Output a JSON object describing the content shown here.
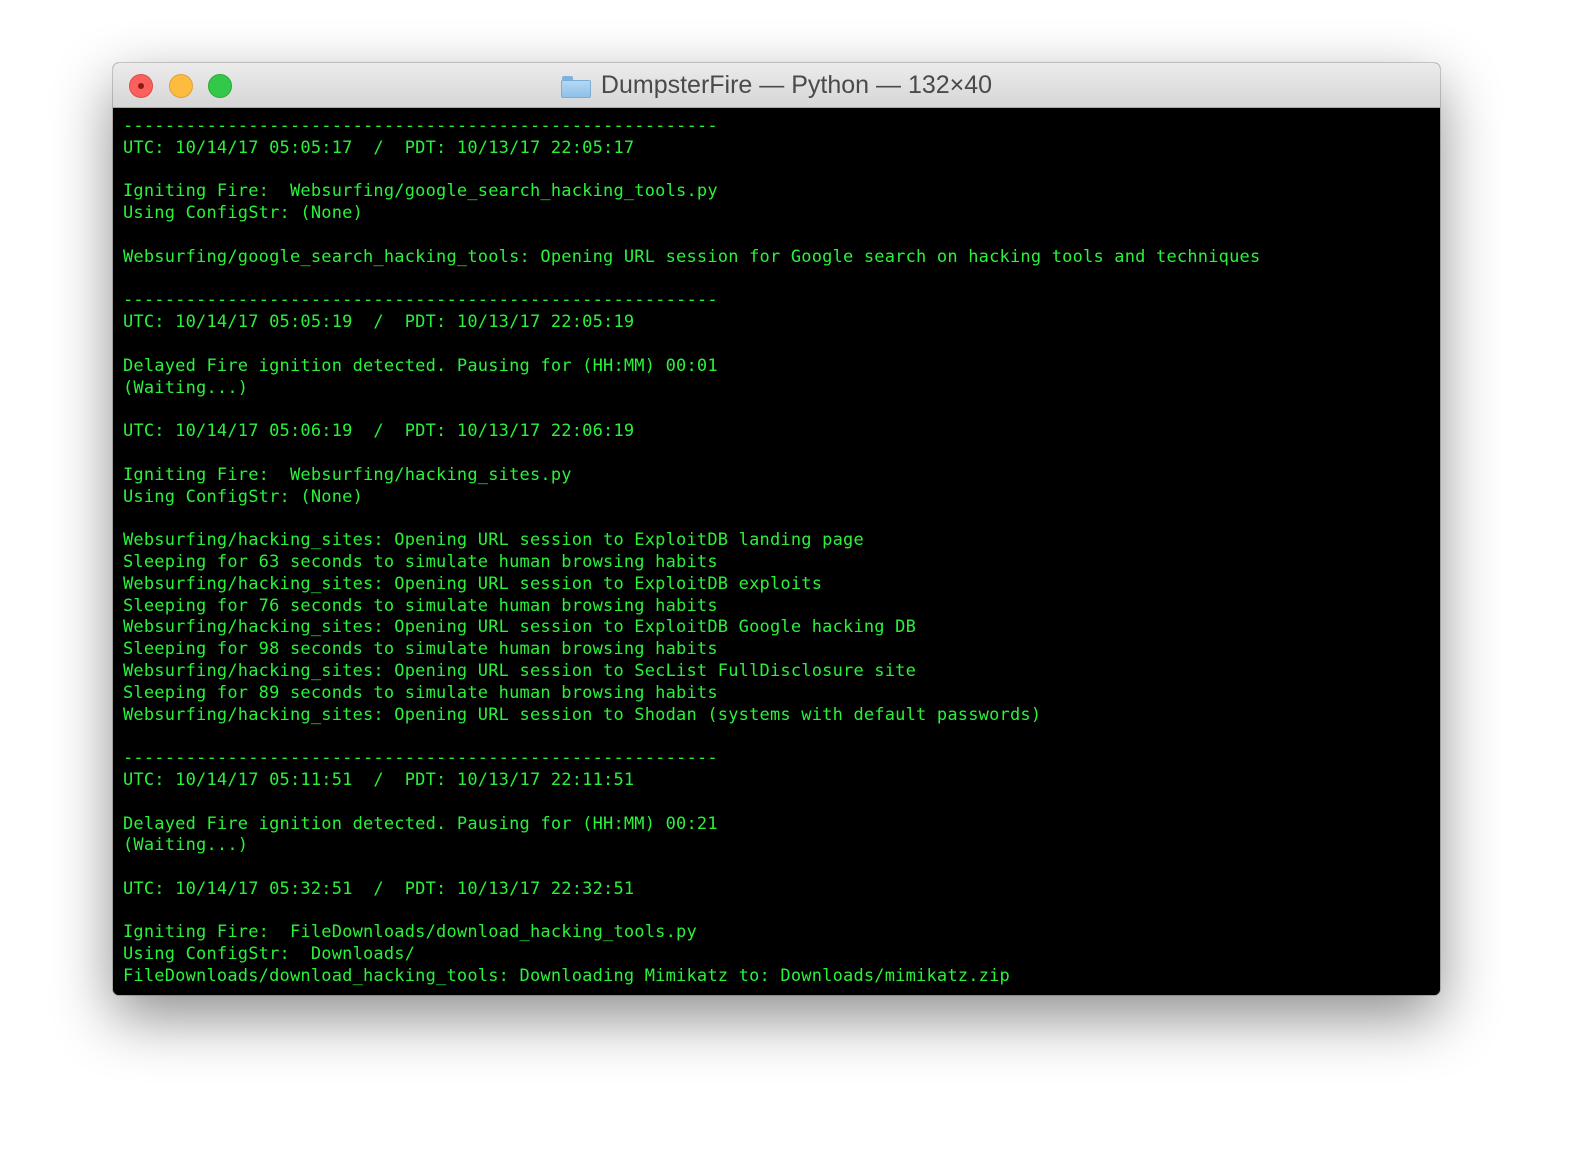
{
  "window": {
    "title": "DumpsterFire — Python — 132×40",
    "title_icon": "folder-icon"
  },
  "colors": {
    "terminal_bg": "#000000",
    "terminal_text": "#2af23b"
  },
  "terminal": {
    "lines": [
      "---------------------------------------------------------",
      "UTC: 10/14/17 05:05:17  /  PDT: 10/13/17 22:05:17",
      "",
      "Igniting Fire:  Websurfing/google_search_hacking_tools.py",
      "Using ConfigStr: (None)",
      "",
      "Websurfing/google_search_hacking_tools: Opening URL session for Google search on hacking tools and techniques",
      "",
      "---------------------------------------------------------",
      "UTC: 10/14/17 05:05:19  /  PDT: 10/13/17 22:05:19",
      "",
      "Delayed Fire ignition detected. Pausing for (HH:MM) 00:01",
      "(Waiting...)",
      "",
      "UTC: 10/14/17 05:06:19  /  PDT: 10/13/17 22:06:19",
      "",
      "Igniting Fire:  Websurfing/hacking_sites.py",
      "Using ConfigStr: (None)",
      "",
      "Websurfing/hacking_sites: Opening URL session to ExploitDB landing page",
      "Sleeping for 63 seconds to simulate human browsing habits",
      "Websurfing/hacking_sites: Opening URL session to ExploitDB exploits",
      "Sleeping for 76 seconds to simulate human browsing habits",
      "Websurfing/hacking_sites: Opening URL session to ExploitDB Google hacking DB",
      "Sleeping for 98 seconds to simulate human browsing habits",
      "Websurfing/hacking_sites: Opening URL session to SecList FullDisclosure site",
      "Sleeping for 89 seconds to simulate human browsing habits",
      "Websurfing/hacking_sites: Opening URL session to Shodan (systems with default passwords)",
      "",
      "---------------------------------------------------------",
      "UTC: 10/14/17 05:11:51  /  PDT: 10/13/17 22:11:51",
      "",
      "Delayed Fire ignition detected. Pausing for (HH:MM) 00:21",
      "(Waiting...)",
      "",
      "UTC: 10/14/17 05:32:51  /  PDT: 10/13/17 22:32:51",
      "",
      "Igniting Fire:  FileDownloads/download_hacking_tools.py",
      "Using ConfigStr:  Downloads/",
      "FileDownloads/download_hacking_tools: Downloading Mimikatz to: Downloads/mimikatz.zip"
    ]
  }
}
